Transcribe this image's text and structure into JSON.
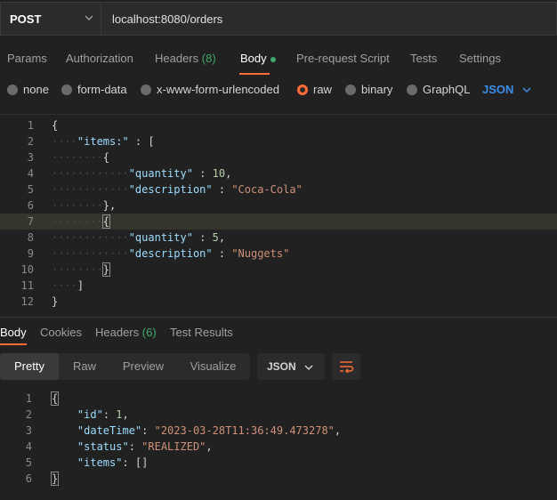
{
  "request": {
    "method": "POST",
    "url": "localhost:8080/orders"
  },
  "request_tabs": {
    "params": "Params",
    "authorization": "Authorization",
    "headers": "Headers",
    "headers_count": "(8)",
    "body": "Body",
    "prerequest": "Pre-request Script",
    "tests": "Tests",
    "settings": "Settings"
  },
  "body_types": {
    "none": "none",
    "form_data": "form-data",
    "urlencoded": "x-www-form-urlencoded",
    "raw": "raw",
    "binary": "binary",
    "graphql": "GraphQL",
    "selected": "raw",
    "language": "JSON"
  },
  "editor": {
    "line_numbers": [
      "1",
      "2",
      "3",
      "4",
      "5",
      "6",
      "7",
      "8",
      "9",
      "10",
      "11",
      "12"
    ],
    "highlighted_line": 7,
    "l2_key": "\"items:\"",
    "l4_key": "\"quantity\"",
    "l4_val": "10",
    "l5_key": "\"description\"",
    "l5_val": "\"Coca-Cola\"",
    "l8_key": "\"quantity\"",
    "l8_val": "5",
    "l9_key": "\"description\"",
    "l9_val": "\"Nuggets\""
  },
  "response_tabs": {
    "body": "Body",
    "cookies": "Cookies",
    "headers": "Headers",
    "headers_count": "(6)",
    "test_results": "Test Results"
  },
  "view_toolbar": {
    "pretty": "Pretty",
    "raw": "Raw",
    "preview": "Preview",
    "visualize": "Visualize",
    "format": "JSON"
  },
  "response": {
    "line_numbers": [
      "1",
      "2",
      "3",
      "4",
      "5",
      "6"
    ],
    "id_key": "\"id\"",
    "id_val": "1",
    "datetime_key": "\"dateTime\"",
    "datetime_val": "\"2023-03-28T11:36:49.473278\"",
    "status_key": "\"status\"",
    "status_val": "\"REALIZED\"",
    "items_key": "\"items\"",
    "items_val": "[]"
  },
  "colors": {
    "accent": "#ff6c37",
    "green": "#3ea86b",
    "json_key": "#9cdcfe",
    "json_string": "#ce9178",
    "json_number": "#b5cea8",
    "language_blue": "#3b8eea"
  }
}
